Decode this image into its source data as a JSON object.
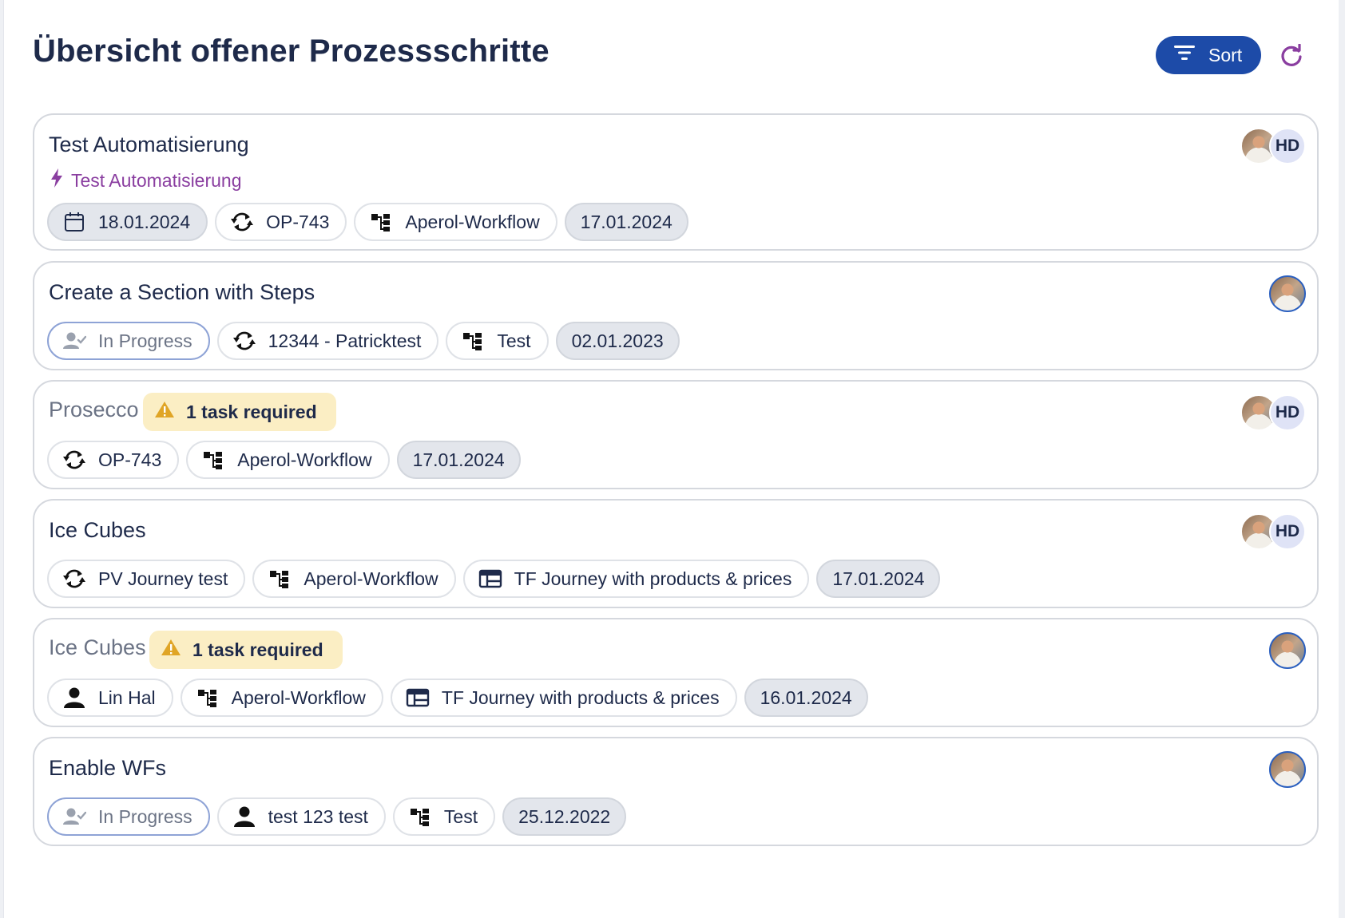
{
  "page": {
    "title": "Übersicht offener Prozessschritte",
    "sort_label": "Sort"
  },
  "colors": {
    "primary": "#1d4ba8",
    "accent_purple": "#8a3ea0",
    "warning_bg": "#fbeec4",
    "warning_icon": "#e0a526",
    "date_chip_bg": "#e3e6ec"
  },
  "cards": [
    {
      "title": "Test Automatisierung",
      "subtitle": "Test Automatisierung",
      "chips": [
        {
          "icon": "calendar-icon",
          "label": "18.01.2024"
        },
        {
          "icon": "sync-icon",
          "label": "OP-743"
        },
        {
          "icon": "workflow-icon",
          "label": "Aperol-Workflow"
        },
        {
          "label": "17.01.2024"
        }
      ],
      "avatars": [
        "photo",
        "HD"
      ]
    },
    {
      "title": "Create a Section with Steps",
      "chips": [
        {
          "icon": "user-check-icon",
          "label": "In Progress"
        },
        {
          "icon": "sync-icon",
          "label": "12344 - Patricktest"
        },
        {
          "icon": "workflow-icon",
          "label": "Test"
        },
        {
          "label": "02.01.2023"
        }
      ],
      "avatars": [
        "photo"
      ]
    },
    {
      "title": "Prosecco",
      "badge": "1 task required",
      "chips": [
        {
          "icon": "sync-icon",
          "label": "OP-743"
        },
        {
          "icon": "workflow-icon",
          "label": "Aperol-Workflow"
        },
        {
          "label": "17.01.2024"
        }
      ],
      "avatars": [
        "photo",
        "HD"
      ]
    },
    {
      "title": "Ice Cubes",
      "chips": [
        {
          "icon": "sync-icon",
          "label": "PV Journey test"
        },
        {
          "icon": "workflow-icon",
          "label": "Aperol-Workflow"
        },
        {
          "icon": "journey-icon",
          "label": "TF Journey with products & prices"
        },
        {
          "label": "17.01.2024"
        }
      ],
      "avatars": [
        "photo",
        "HD"
      ]
    },
    {
      "title": "Ice Cubes",
      "badge": "1 task required",
      "chips": [
        {
          "icon": "person-icon",
          "label": "Lin Hal"
        },
        {
          "icon": "workflow-icon",
          "label": "Aperol-Workflow"
        },
        {
          "icon": "journey-icon",
          "label": "TF Journey with products & prices"
        },
        {
          "label": "16.01.2024"
        }
      ],
      "avatars": [
        "photo"
      ]
    },
    {
      "title": "Enable WFs",
      "chips": [
        {
          "icon": "user-check-icon",
          "label": "In Progress"
        },
        {
          "icon": "person-icon",
          "label": "test 123 test"
        },
        {
          "icon": "workflow-icon",
          "label": "Test"
        },
        {
          "label": "25.12.2022"
        }
      ],
      "avatars": [
        "photo"
      ]
    }
  ]
}
